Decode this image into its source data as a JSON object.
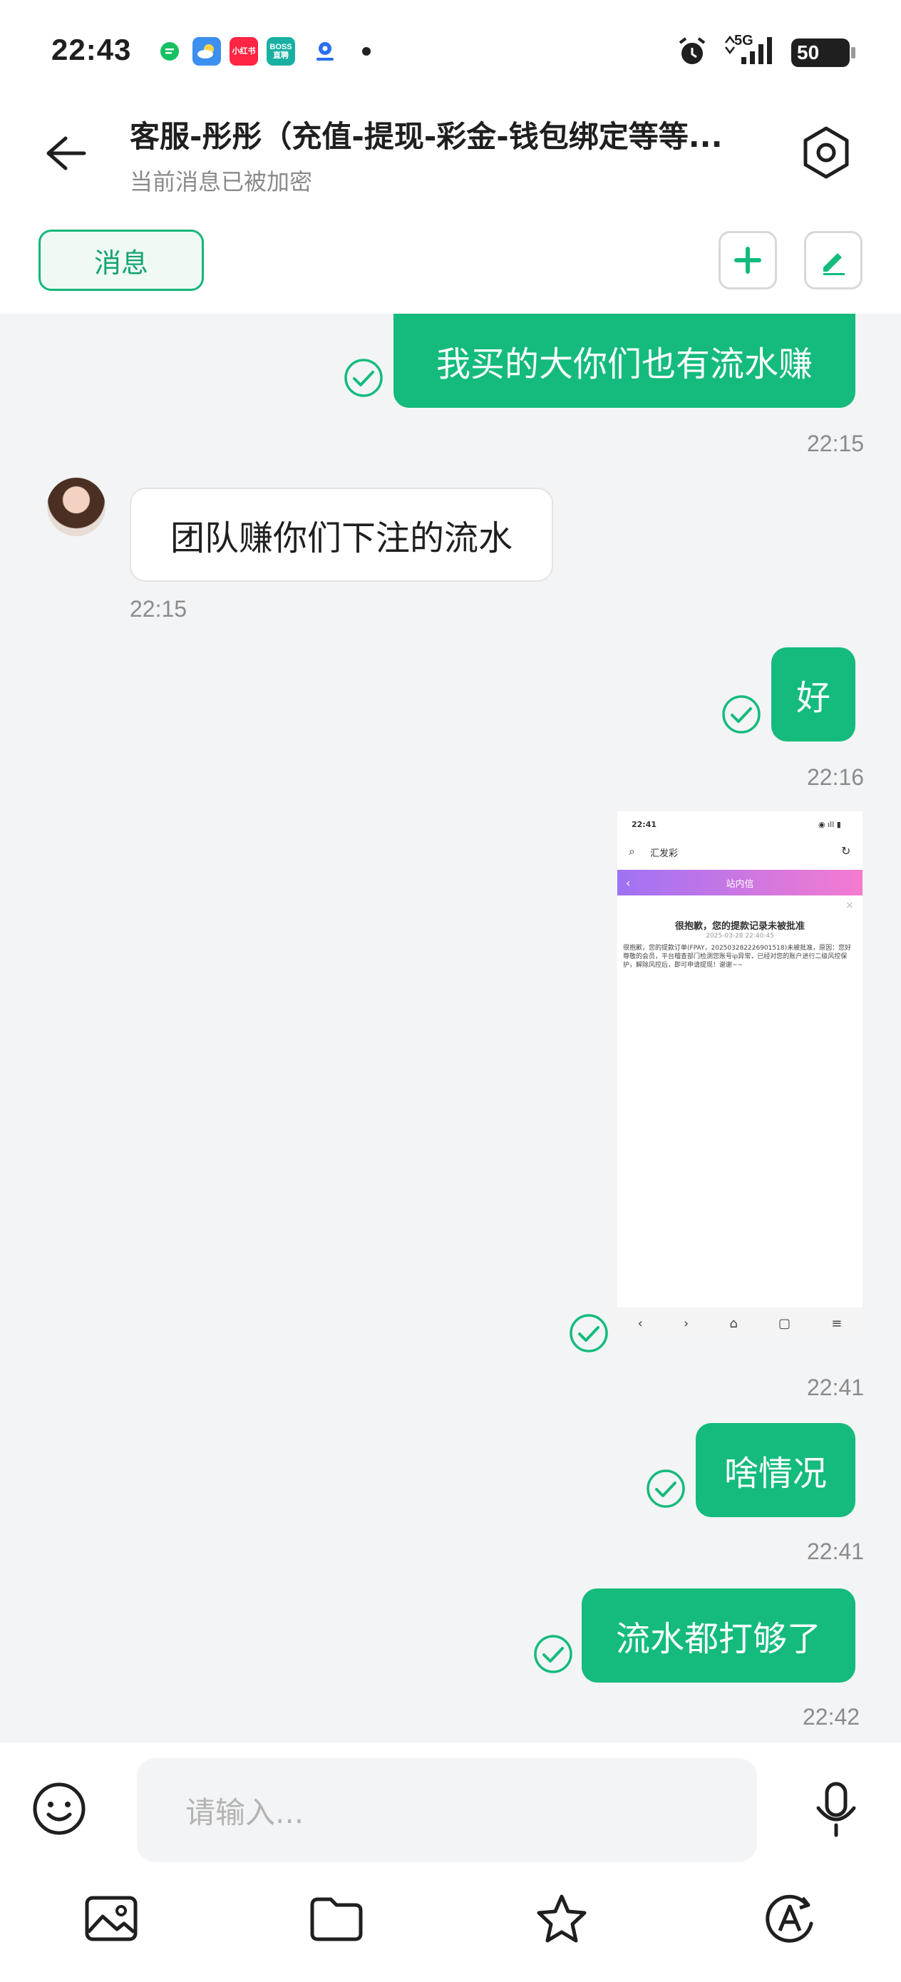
{
  "status_bar": {
    "time": "22:43",
    "apps": [
      {
        "icon": "messages-icon",
        "label": "",
        "color": "#16c060"
      },
      {
        "icon": "weather-icon",
        "label": "",
        "color": "#3d8ff0"
      },
      {
        "icon": "xiaohongshu-icon",
        "label": "小红书",
        "color": "#ff2442"
      },
      {
        "icon": "boss-icon",
        "label": "BOSS 直聘",
        "color": "#19b0a2"
      },
      {
        "icon": "map-icon",
        "label": "",
        "color": "#2a6ef0"
      }
    ],
    "network": "5G",
    "battery": "50"
  },
  "header": {
    "title": "客服-彤彤（充值-提现-彩金-钱包绑定等等...",
    "subtitle": "当前消息已被加密",
    "tab_label": "消息"
  },
  "messages": [
    {
      "direction": "out",
      "text": "我买的大你们也有流水赚",
      "time": "22:15"
    },
    {
      "direction": "in",
      "text": "团队赚你们下注的流水",
      "time": "22:15"
    },
    {
      "direction": "out",
      "text": "好",
      "time": "22:16"
    },
    {
      "direction": "out",
      "type": "image",
      "time": "22:41",
      "image": {
        "time": "22:41",
        "search_text": "汇发彩",
        "bar_title": "站内信",
        "heading": "很抱歉，您的提款记录未被批准",
        "date": "2025-03-28 22:40:45",
        "body": "很抱歉，您的提款订单(FPAY，202503282226901518)未被批准，原因：您好尊敬的会员，平台稽查部门检测您账号ip异常，已经对您的账户进行二级风控保护，解除风控后，即可申请提现！谢谢~~"
      }
    },
    {
      "direction": "out",
      "text": "啥情况",
      "time": "22:41"
    },
    {
      "direction": "out",
      "text": "流水都打够了",
      "time": "22:42"
    }
  ],
  "input": {
    "placeholder": "请输入..."
  },
  "colors": {
    "accent": "#14bb7c",
    "chat_bg": "#f3f4f6"
  }
}
